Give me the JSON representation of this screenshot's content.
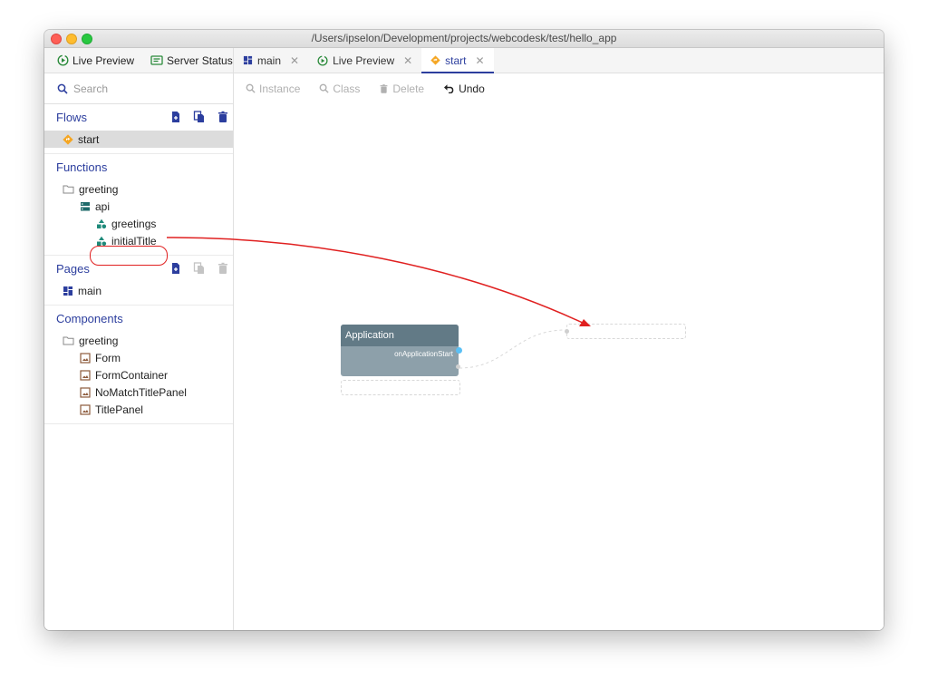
{
  "window": {
    "title": "/Users/ipselon/Development/projects/webcodesk/test/hello_app"
  },
  "left_panel": {
    "top_buttons": [
      {
        "label": "Live Preview",
        "icon": "live-preview-icon"
      },
      {
        "label": "Server Status",
        "icon": "server-status-icon"
      }
    ],
    "search": {
      "placeholder": "Search"
    },
    "flows": {
      "title": "Flows",
      "items": [
        {
          "label": "start",
          "icon": "flow-icon",
          "selected": true
        }
      ]
    },
    "functions": {
      "title": "Functions",
      "tree": [
        {
          "label": "greeting",
          "icon": "folder-icon",
          "level": 1
        },
        {
          "label": "api",
          "icon": "module-icon",
          "level": 2
        },
        {
          "label": "greetings",
          "icon": "function-icon",
          "level": 3
        },
        {
          "label": "initialTitle",
          "icon": "function-icon",
          "level": 3,
          "highlighted": true
        }
      ]
    },
    "pages": {
      "title": "Pages",
      "items": [
        {
          "label": "main",
          "icon": "page-icon"
        }
      ]
    },
    "components": {
      "title": "Components",
      "tree": [
        {
          "label": "greeting",
          "icon": "folder-icon",
          "level": 1
        },
        {
          "label": "Form",
          "icon": "component-icon",
          "level": 2
        },
        {
          "label": "FormContainer",
          "icon": "component-icon",
          "level": 2
        },
        {
          "label": "NoMatchTitlePanel",
          "icon": "component-icon",
          "level": 2
        },
        {
          "label": "TitlePanel",
          "icon": "component-icon",
          "level": 2
        }
      ]
    }
  },
  "tabs": [
    {
      "label": "main",
      "icon": "page-icon",
      "active": false
    },
    {
      "label": "Live Preview",
      "icon": "live-preview-icon",
      "active": false
    },
    {
      "label": "start",
      "icon": "flow-icon",
      "active": true
    }
  ],
  "toolbar": {
    "instance_label": "Instance",
    "class_label": "Class",
    "delete_label": "Delete",
    "undo_label": "Undo"
  },
  "canvas": {
    "app_node": {
      "title": "Application",
      "output_port": "onApplicationStart"
    }
  },
  "colors": {
    "accent": "#2c3e9e",
    "flow_icon": "#f5a623",
    "function_icon": "#1e8a7a",
    "component_icon": "#8d5a3b",
    "annotation": "#e02020",
    "port_active": "#5bc0f5"
  }
}
